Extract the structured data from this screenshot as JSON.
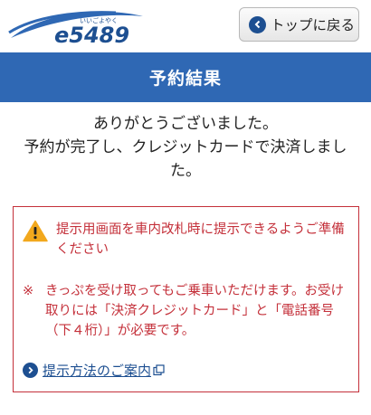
{
  "header": {
    "logo": {
      "text": "e5489",
      "ruby": "いいごよやく",
      "icon": "e5489-logo"
    },
    "top_button": {
      "label": "トップに戻る",
      "icon": "chevron-left-icon"
    }
  },
  "title": "予約結果",
  "message": {
    "line1": "ありがとうございました。",
    "line2": "予約が完了し、クレジットカードで決済しまし",
    "line3": "た。"
  },
  "notice": {
    "warning_icon": "warning-icon",
    "warning_text": "提示用画面を車内改札時に提示できるようご準備ください",
    "note_mark": "※",
    "note_text": "きっぷを受け取ってもご乗車いただけます。お受け取りには「決済クレジットカード」と「電話番号（下４桁）」が必要です。",
    "link": {
      "label": "提示方法のご案内",
      "icon": "external-link-icon"
    }
  },
  "colors": {
    "brand_blue": "#2f68b4",
    "dark_blue": "#1d4f91",
    "warning_red": "#c4303a",
    "warning_yellow": "#f2a81d"
  }
}
